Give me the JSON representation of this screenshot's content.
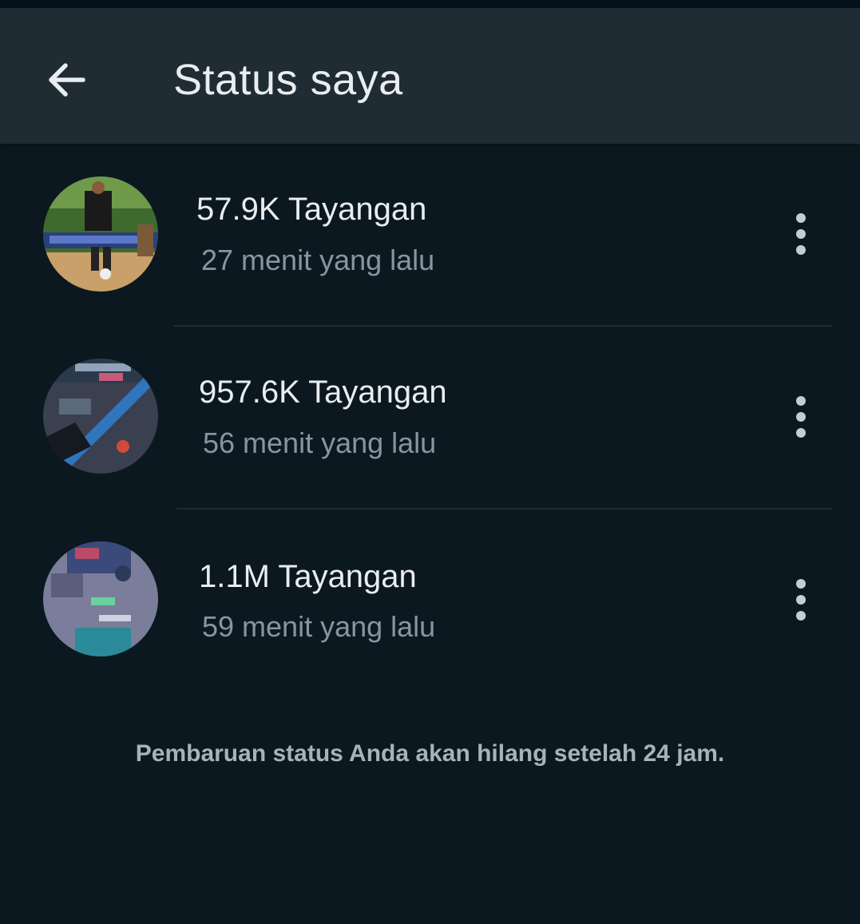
{
  "header": {
    "title": "Status saya",
    "back_icon": "arrow-left-icon"
  },
  "statuses": [
    {
      "views": "57.9K Tayangan",
      "time": "27 menit yang lalu",
      "menu_icon": "more-vertical-icon"
    },
    {
      "views": "957.6K Tayangan",
      "time": "56 menit yang lalu",
      "menu_icon": "more-vertical-icon"
    },
    {
      "views": "1.1M Tayangan",
      "time": "59 menit yang lalu",
      "menu_icon": "more-vertical-icon"
    }
  ],
  "footer": {
    "note": "Pembaruan status Anda akan hilang setelah 24 jam."
  },
  "colors": {
    "background": "#0c1820",
    "app_bar": "#202c33",
    "primary_text": "#e9edef",
    "secondary_text": "#8696a0"
  }
}
